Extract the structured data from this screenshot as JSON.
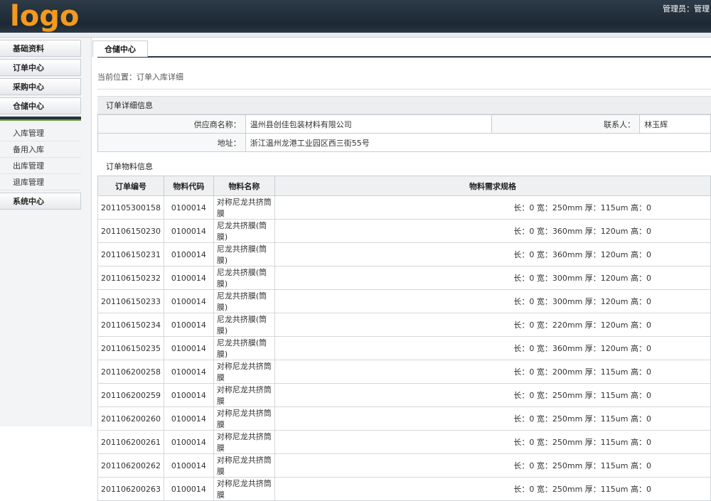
{
  "header": {
    "logo": "logo",
    "user": "管理员：管理"
  },
  "sidebar": {
    "menus_top": [
      "基础资料",
      "订单中心",
      "采购中心",
      "仓储中心"
    ],
    "sub_items": [
      "入库管理",
      "备用入库",
      "出库管理",
      "退库管理"
    ],
    "menus_bottom": [
      "系统中心"
    ]
  },
  "tab": "仓储中心",
  "breadcrumb": "当前位置：订单入库详细",
  "order_section": "订单详细信息",
  "info": {
    "supplier_label": "供应商名称：",
    "supplier": "温州县创佳包装材料有限公司",
    "contact_label": "联系人：",
    "contact": "林玉辉",
    "address_label": "地址：",
    "address": "浙江温州龙港工业园区西三街55号"
  },
  "items_section": "订单物料信息",
  "columns": [
    "订单编号",
    "物料代码",
    "物料名称",
    "物料需求规格"
  ],
  "rows": [
    [
      "201105300158",
      "0100014",
      "对称尼龙共挤筒膜",
      "长：0 宽：250mm 厚：115um 高：0"
    ],
    [
      "201106150230",
      "0100014",
      "尼龙共挤膜(筒膜)",
      "长：0 宽：360mm 厚：120um 高：0"
    ],
    [
      "201106150231",
      "0100014",
      "尼龙共挤膜(筒膜)",
      "长：0 宽：360mm 厚：120um 高：0"
    ],
    [
      "201106150232",
      "0100014",
      "尼龙共挤膜(筒膜)",
      "长：0 宽：300mm 厚：120um 高：0"
    ],
    [
      "201106150233",
      "0100014",
      "尼龙共挤膜(筒膜)",
      "长：0 宽：300mm 厚：120um 高：0"
    ],
    [
      "201106150234",
      "0100014",
      "尼龙共挤膜(筒膜)",
      "长：0 宽：220mm 厚：120um 高：0"
    ],
    [
      "201106150235",
      "0100014",
      "尼龙共挤膜(筒膜)",
      "长：0 宽：360mm 厚：120um 高：0"
    ],
    [
      "201106200258",
      "0100014",
      "对称尼龙共挤筒膜",
      "长：0 宽：200mm 厚：115um 高：0"
    ],
    [
      "201106200259",
      "0100014",
      "对称尼龙共挤筒膜",
      "长：0 宽：250mm 厚：115um 高：0"
    ],
    [
      "201106200260",
      "0100014",
      "对称尼龙共挤筒膜",
      "长：0 宽：250mm 厚：115um 高：0"
    ],
    [
      "201106200261",
      "0100014",
      "对称尼龙共挤筒膜",
      "长：0 宽：250mm 厚：115um 高：0"
    ],
    [
      "201106200262",
      "0100014",
      "对称尼龙共挤筒膜",
      "长：0 宽：250mm 厚：115um 高：0"
    ],
    [
      "201106200263",
      "0100014",
      "对称尼龙共挤筒膜",
      "长：0 宽：250mm 厚：115um 高：0"
    ]
  ]
}
